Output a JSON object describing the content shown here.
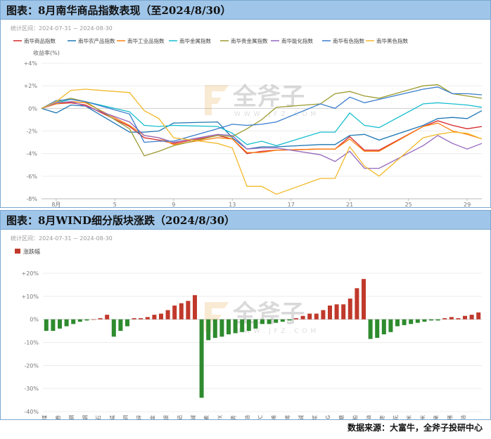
{
  "panels": {
    "top": {
      "title": "图表：8月南华商品指数表现（至2024/8/30）",
      "range_label": "统计区间：2024-07-31 ~ 2024-08-30"
    },
    "bottom": {
      "title": "图表：8月WIND细分版块涨跌（2024/8/30）",
      "range_label": "统计区间：2024-07-31 ~ 2024-08-30"
    }
  },
  "watermark": {
    "text": "全斧子",
    "url": "W W W . J F Z . C O M"
  },
  "source": "数据来源：大富牛，全斧子投研中心",
  "chart_data": [
    {
      "type": "line",
      "ylabel": "收益率(%)",
      "ylim": [
        -8,
        4
      ],
      "yticks": [
        -8,
        -6,
        -4,
        -2,
        0,
        2,
        4
      ],
      "ytick_labels": [
        "-8%",
        "-6%",
        "-4%",
        "-2%",
        "0%",
        "+2%",
        "+4%"
      ],
      "xlim": [
        0,
        30
      ],
      "xticks": [
        1,
        5,
        9,
        13,
        17,
        21,
        25,
        29
      ],
      "xtick_labels": [
        "8月",
        "5",
        "9",
        "13",
        "17",
        "21",
        "25",
        "29"
      ],
      "grid": true,
      "legend_position": "top",
      "x": [
        0,
        1,
        2,
        3,
        6,
        7,
        8,
        9,
        12,
        13,
        14,
        15,
        16,
        19,
        20,
        21,
        22,
        23,
        26,
        27,
        28,
        29,
        30
      ],
      "series": [
        {
          "name": "南华商品指数",
          "color": "#d62728",
          "values": [
            0,
            0.4,
            0.5,
            0.3,
            -1.6,
            -2.6,
            -2.8,
            -3.1,
            -2.4,
            -2.7,
            -4.0,
            -3.8,
            -3.7,
            -3.6,
            -3.6,
            -2.5,
            -3.7,
            -3.7,
            -1.6,
            -1.1,
            -1.5,
            -1.8,
            -1.6
          ]
        },
        {
          "name": "南华农产品指数",
          "color": "#1f77b4",
          "values": [
            0,
            -0.4,
            0.3,
            0.2,
            -2.1,
            -2.1,
            -2.0,
            -1.3,
            -1.2,
            -2.6,
            -3.6,
            -3.4,
            -3.4,
            -3.2,
            -3.2,
            -2.4,
            -2.3,
            -2.8,
            -1.5,
            -0.9,
            -0.8,
            -0.9,
            -0.2
          ]
        },
        {
          "name": "南华工业品指数",
          "color": "#ff7f0e",
          "values": [
            0,
            0.4,
            0.6,
            0.5,
            -1.5,
            -2.4,
            -2.6,
            -3.2,
            -2.6,
            -2.7,
            -3.9,
            -3.9,
            -3.7,
            -3.6,
            -3.6,
            -2.7,
            -3.8,
            -3.8,
            -1.6,
            -1.3,
            -2.0,
            -2.3,
            -2.7
          ]
        },
        {
          "name": "南华金属指数",
          "color": "#17becf",
          "values": [
            0,
            0.5,
            0.8,
            0.6,
            -0.3,
            -1.5,
            -1.6,
            -1.5,
            -1.6,
            -2.2,
            -3.2,
            -2.9,
            -3.3,
            -2.1,
            -2.1,
            -0.4,
            -1.5,
            -1.7,
            0.4,
            0.5,
            0.4,
            0.3,
            0.1
          ]
        },
        {
          "name": "南华贵金属指数",
          "color": "#9b9b2f",
          "values": [
            0,
            0.6,
            0.9,
            0.6,
            -1.8,
            -4.2,
            -3.8,
            -3.3,
            -2.4,
            -2.5,
            -1.8,
            -1.0,
            0.1,
            0.4,
            1.3,
            1.5,
            1.1,
            0.9,
            2.0,
            2.1,
            1.3,
            1.1,
            0.9
          ]
        },
        {
          "name": "南华能化指数",
          "color": "#9467bd",
          "values": [
            0,
            0.5,
            0.6,
            0.2,
            -1.2,
            -2.4,
            -2.6,
            -3.0,
            -2.3,
            -2.4,
            -3.6,
            -3.5,
            -3.5,
            -4.1,
            -4.7,
            -3.8,
            -5.3,
            -5.3,
            -3.3,
            -2.4,
            -3.1,
            -3.6,
            -3.1
          ]
        },
        {
          "name": "南华有色指数",
          "color": "#3a7dcc",
          "values": [
            0,
            0.7,
            0.8,
            0.6,
            -0.5,
            -3.0,
            -2.9,
            -2.9,
            -1.8,
            -1.4,
            -1.5,
            -1.4,
            -1.2,
            0.4,
            0.0,
            1.0,
            0.5,
            0.8,
            1.7,
            1.9,
            1.3,
            1.3,
            1.2
          ]
        },
        {
          "name": "南华黑色指数",
          "color": "#f2b92b",
          "values": [
            0,
            0.6,
            1.6,
            1.7,
            1.4,
            -0.2,
            -0.9,
            -2.6,
            -3.1,
            -3.5,
            -6.9,
            -6.9,
            -7.6,
            -6.2,
            -6.2,
            -3.4,
            -5.1,
            -6.0,
            -2.6,
            -2.3,
            -2.1,
            -2.2,
            -2.7
          ]
        }
      ]
    },
    {
      "type": "bar",
      "legend": "涨跌幅",
      "legend_position": "top-left",
      "ylim": [
        -40,
        20
      ],
      "yticks": [
        -40,
        -30,
        -20,
        -10,
        0,
        10,
        20
      ],
      "ytick_labels": [
        "-40%",
        "-30%",
        "-20%",
        "-10%",
        "0%",
        "+10%",
        "+20%"
      ],
      "grid": true,
      "positive_color": "#c0392b",
      "negative_color": "#2e8b2e",
      "categories": [
        "焦煤",
        "",
        "热卷",
        "",
        "螺纹钢",
        "",
        "不锈钢",
        "",
        "铁矿石",
        "",
        "硅锰",
        "",
        "国际铜",
        "",
        "沪锌",
        "",
        "沪金",
        "",
        "沪银",
        "",
        "氧化铝",
        "",
        "纯碱",
        "",
        "尿素",
        "",
        "PX",
        "",
        "沥青",
        "",
        "低硫燃料油",
        "",
        "PVC",
        "",
        "聚丙烯",
        "",
        "苯乙烯",
        "",
        "烧碱",
        "",
        "纸浆",
        "",
        "LPG",
        "",
        "白糖",
        "",
        "菜粕",
        "",
        "豆油",
        "",
        "红枣",
        "",
        "棉花",
        "",
        "粳米",
        "",
        "玉米",
        "",
        "苹果",
        "",
        "生猪",
        "",
        "棕榈油"
      ],
      "values": [
        -5,
        -5,
        -4,
        -3,
        -2,
        -1,
        -0.5,
        0,
        0.5,
        2,
        -7.5,
        -5,
        -3,
        0.5,
        0.5,
        1,
        2,
        2.5,
        4,
        6,
        7,
        8,
        10.5,
        -34,
        -9,
        -8,
        -7.5,
        -6.5,
        -6,
        -5.5,
        -5,
        -4,
        -2,
        -2,
        -1.5,
        -1,
        -0.5,
        0.5,
        1.5,
        2.5,
        2.5,
        4,
        6,
        6.5,
        6.5,
        9,
        13.5,
        17.5,
        -8.5,
        -8,
        -6.5,
        -5.5,
        -3,
        -2.5,
        -2,
        -1.5,
        -1,
        -0.5,
        -0.5,
        0.5,
        1,
        0.5,
        1.5,
        2,
        3
      ]
    }
  ]
}
